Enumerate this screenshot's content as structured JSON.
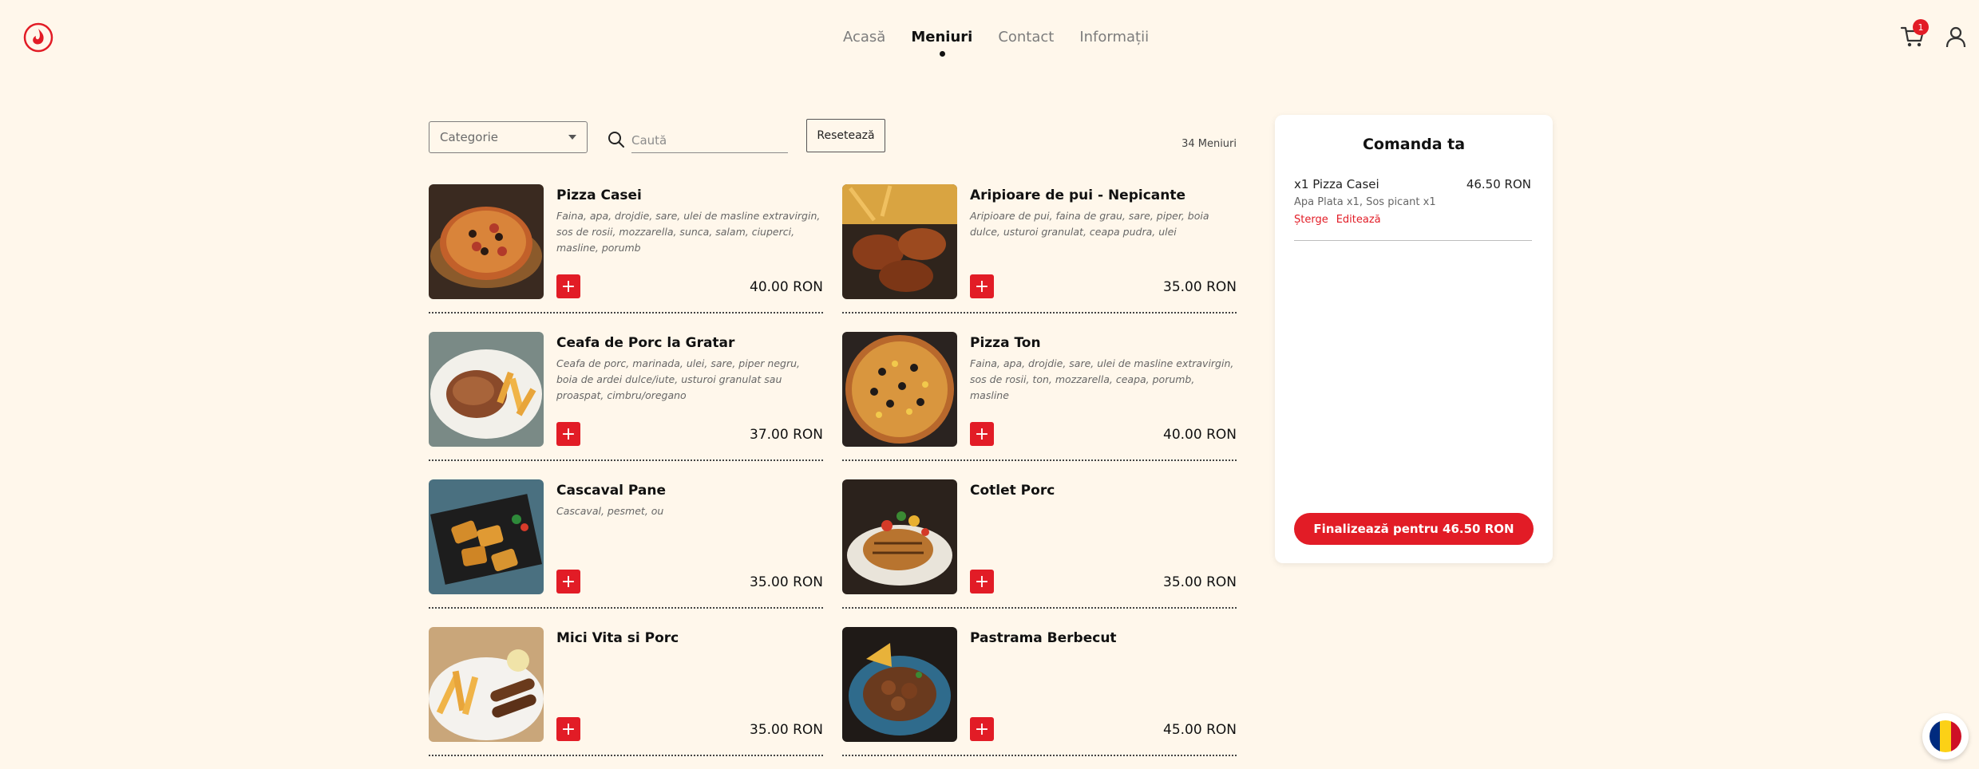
{
  "header": {
    "nav": [
      {
        "label": "Acasă",
        "active": false
      },
      {
        "label": "Meniuri",
        "active": true
      },
      {
        "label": "Contact",
        "active": false
      },
      {
        "label": "Informații",
        "active": false
      }
    ],
    "cart_count": "1",
    "colors": {
      "accent": "#e21c26",
      "background": "#fff7eb"
    }
  },
  "filters": {
    "category_placeholder": "Categorie",
    "search_placeholder": "Caută",
    "reset_label": "Resetează",
    "count_label": "34 Meniuri"
  },
  "menu": [
    {
      "name": "Pizza Casei",
      "description": "Faina, apa, drojdie, sare, ulei de masline extravirgin, sos de rosii, mozzarella, sunca, salam, ciuperci, masline, porumb",
      "price": "40.00 RON"
    },
    {
      "name": "Aripioare de pui - Nepicante",
      "description": "Aripioare de pui, faina de grau, sare, piper, boia dulce, usturoi granulat, ceapa pudra, ulei",
      "price": "35.00 RON"
    },
    {
      "name": "Ceafa de Porc la Gratar",
      "description": "Ceafa de porc, marinada, ulei, sare, piper negru, boia de ardei dulce/iute, usturoi granulat sau proaspat, cimbru/oregano",
      "price": "37.00 RON"
    },
    {
      "name": "Pizza Ton",
      "description": "Faina, apa, drojdie, sare, ulei de masline extravirgin, sos de rosii, ton, mozzarella, ceapa, porumb, masline",
      "price": "40.00 RON"
    },
    {
      "name": "Cascaval Pane",
      "description": "Cascaval, pesmet, ou",
      "price": "35.00 RON"
    },
    {
      "name": "Cotlet Porc",
      "description": "",
      "price": "35.00 RON"
    },
    {
      "name": "Mici Vita si Porc",
      "description": "",
      "price": "35.00 RON"
    },
    {
      "name": "Pastrama Berbecut",
      "description": "",
      "price": "45.00 RON"
    }
  ],
  "order": {
    "title": "Comanda ta",
    "items": [
      {
        "name": "x1 Pizza Casei",
        "price": "46.50 RON",
        "extras": "Apa Plata x1, Sos picant x1",
        "delete_label": "Șterge",
        "edit_label": "Editează"
      }
    ],
    "checkout_label": "Finalizează pentru 46.50 RON"
  }
}
